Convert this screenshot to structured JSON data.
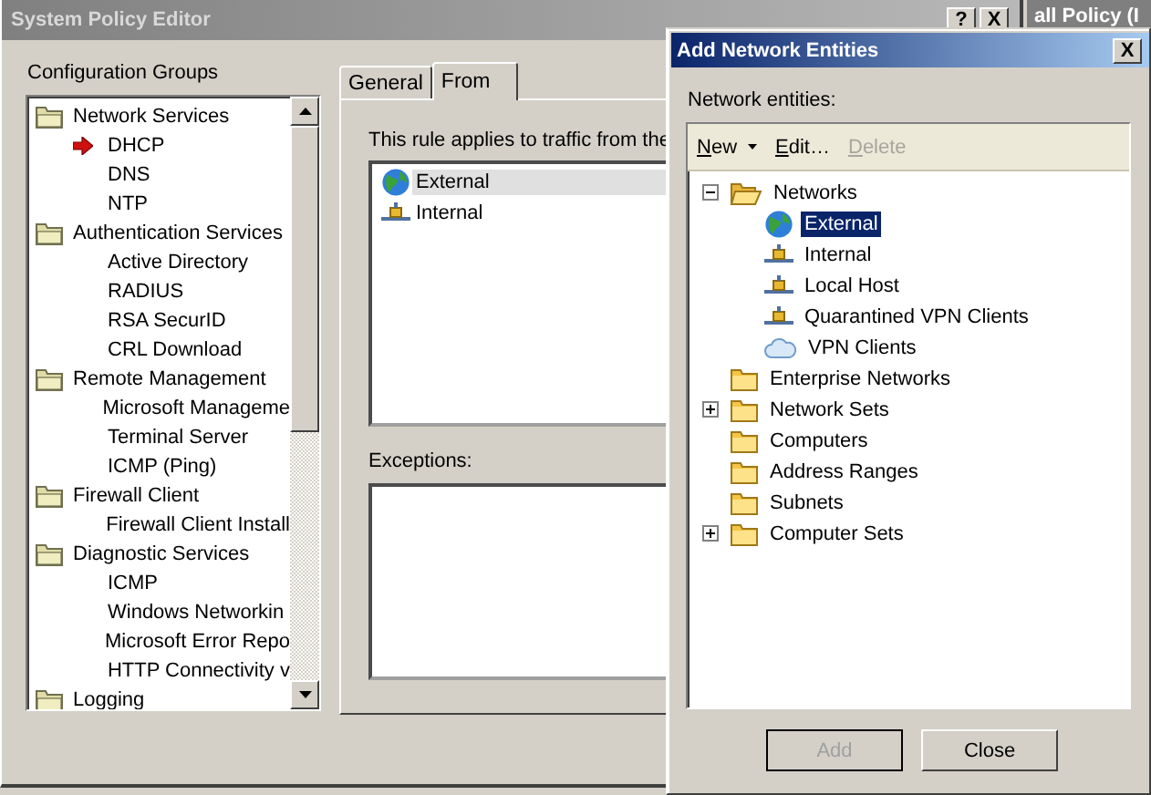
{
  "background_window": {
    "title": "all Policy (I"
  },
  "window": {
    "title": "System Policy Editor",
    "help_button": "?",
    "close_button": "X"
  },
  "config_groups": {
    "label": "Configuration Groups",
    "items": [
      {
        "label": "Network Services",
        "children": [
          {
            "label": "DHCP",
            "current": true
          },
          {
            "label": "DNS",
            "current": false
          },
          {
            "label": "NTP",
            "current": false
          }
        ]
      },
      {
        "label": "Authentication Services",
        "children": [
          {
            "label": "Active Directory",
            "current": false
          },
          {
            "label": "RADIUS",
            "current": false
          },
          {
            "label": "RSA SecurID",
            "current": false
          },
          {
            "label": "CRL Download",
            "current": false
          }
        ]
      },
      {
        "label": "Remote Management",
        "children": [
          {
            "label": "Microsoft Manageme",
            "current": false
          },
          {
            "label": "Terminal Server",
            "current": false
          },
          {
            "label": "ICMP (Ping)",
            "current": false
          }
        ]
      },
      {
        "label": "Firewall Client",
        "children": [
          {
            "label": "Firewall Client Install",
            "current": false
          }
        ]
      },
      {
        "label": "Diagnostic Services",
        "children": [
          {
            "label": "ICMP",
            "current": false
          },
          {
            "label": "Windows Networkin",
            "current": false
          },
          {
            "label": "Microsoft Error Repo",
            "current": false
          },
          {
            "label": "HTTP Connectivity v",
            "current": false
          }
        ]
      },
      {
        "label": "Logging"
      }
    ]
  },
  "tabs": [
    {
      "label": "General",
      "selected": false
    },
    {
      "label": "From",
      "selected": true
    }
  ],
  "from_tab": {
    "description": "This rule applies to traffic from the",
    "sources": [
      {
        "label": "External",
        "kind": "globe",
        "selected": true
      },
      {
        "label": "Internal",
        "kind": "network",
        "selected": false
      }
    ],
    "exceptions_label": "Exceptions:"
  },
  "dialog": {
    "title": "Add Network Entities",
    "close_button": "X",
    "list_label": "Network entities:",
    "toolbar": [
      {
        "label": "New",
        "kind": "dropdown",
        "disabled": false
      },
      {
        "label": "Edit…",
        "kind": "button",
        "disabled": false
      },
      {
        "label": "Delete",
        "kind": "button",
        "disabled": true
      }
    ],
    "tree": [
      {
        "label": "Networks",
        "expanded": true,
        "children": [
          {
            "label": "External",
            "kind": "globe",
            "selected": true
          },
          {
            "label": "Internal",
            "kind": "network",
            "selected": false
          },
          {
            "label": "Local Host",
            "kind": "network",
            "selected": false
          },
          {
            "label": "Quarantined VPN Clients",
            "kind": "network",
            "selected": false
          },
          {
            "label": "VPN Clients",
            "kind": "cloud",
            "selected": false
          }
        ]
      },
      {
        "label": "Enterprise Networks"
      },
      {
        "label": "Network Sets",
        "expanded": false
      },
      {
        "label": "Computers"
      },
      {
        "label": "Address Ranges"
      },
      {
        "label": "Subnets"
      },
      {
        "label": "Computer Sets",
        "expanded": false
      }
    ],
    "buttons": [
      {
        "label": "Add",
        "disabled": true
      },
      {
        "label": "Close",
        "disabled": false
      }
    ]
  }
}
